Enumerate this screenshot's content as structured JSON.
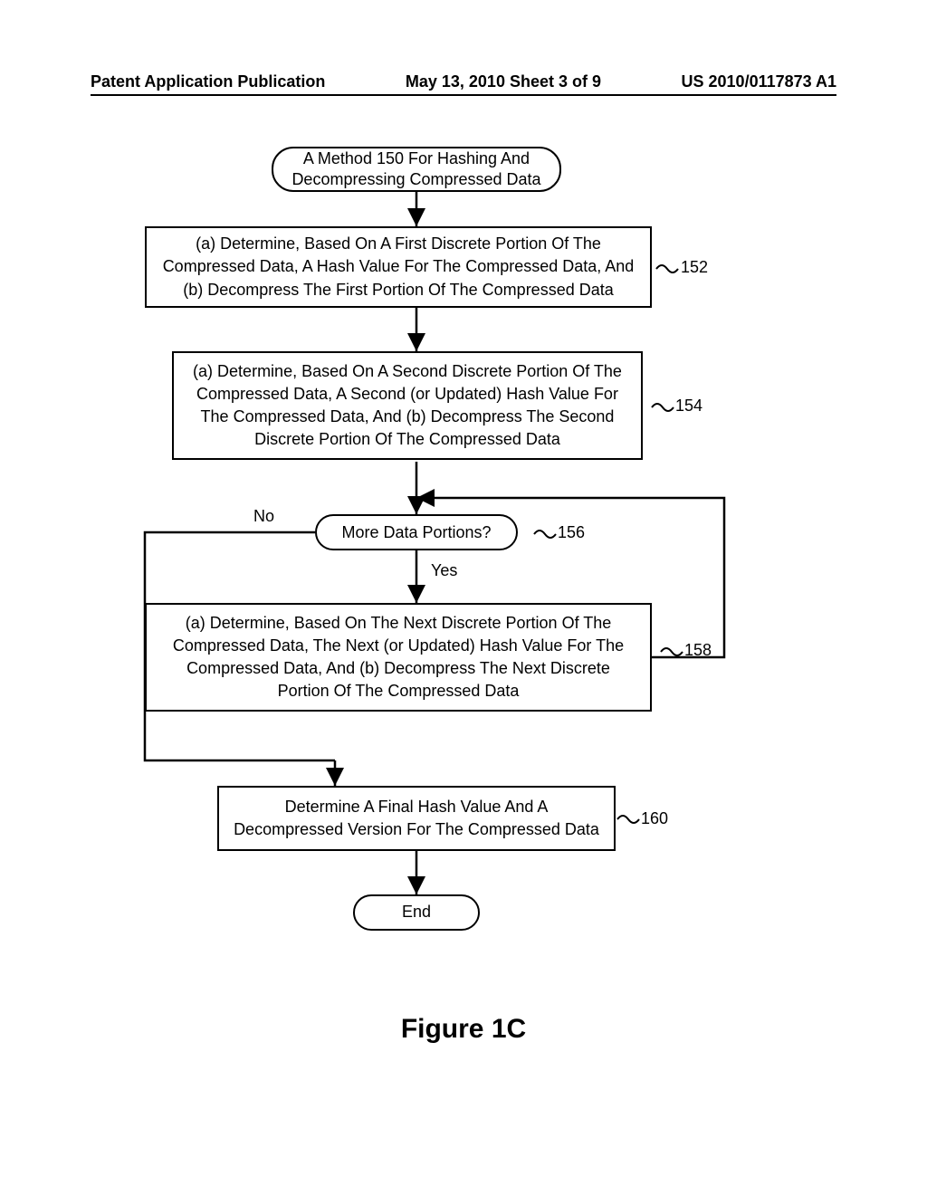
{
  "header": {
    "left": "Patent Application Publication",
    "center": "May 13, 2010  Sheet 3 of 9",
    "right": "US 2010/0117873 A1"
  },
  "flow": {
    "start": "A Method 150 For Hashing And Decompressing Compressed Data",
    "step152": "(a) Determine, Based On A First Discrete Portion Of The Compressed Data, A Hash Value For The Compressed Data, And (b) Decompress The First Portion Of The Compressed Data",
    "step154": "(a) Determine, Based On A Second Discrete Portion Of The Compressed Data, A Second (or Updated) Hash Value For The Compressed Data, And (b) Decompress The Second Discrete Portion Of The Compressed Data",
    "decision156": "More Data Portions?",
    "step158": "(a) Determine, Based On The Next Discrete Portion Of The Compressed Data, The Next (or Updated)  Hash Value For The Compressed Data, And (b) Decompress The Next Discrete Portion Of The Compressed Data",
    "step160": "Determine A Final Hash Value And A Decompressed Version For The Compressed Data",
    "end": "End"
  },
  "refs": {
    "r152": "152",
    "r154": "154",
    "r156": "156",
    "r158": "158",
    "r160": "160"
  },
  "labels": {
    "no": "No",
    "yes": "Yes"
  },
  "figure": "Figure 1C",
  "chart_data": {
    "type": "flowchart",
    "title": "A Method 150 For Hashing And Decompressing Compressed Data",
    "nodes": [
      {
        "id": "start",
        "shape": "terminator",
        "text": "A Method 150 For Hashing And Decompressing Compressed Data"
      },
      {
        "id": "152",
        "shape": "process",
        "text": "(a) Determine, Based On A First Discrete Portion Of The Compressed Data, A Hash Value For The Compressed Data, And (b) Decompress The First Portion Of The Compressed Data"
      },
      {
        "id": "154",
        "shape": "process",
        "text": "(a) Determine, Based On A Second Discrete Portion Of The Compressed Data, A Second (or Updated) Hash Value For The Compressed Data, And (b) Decompress The Second Discrete Portion Of The Compressed Data"
      },
      {
        "id": "156",
        "shape": "decision",
        "text": "More Data Portions?"
      },
      {
        "id": "158",
        "shape": "process",
        "text": "(a) Determine, Based On The Next Discrete Portion Of The Compressed Data, The Next (or Updated) Hash Value For The Compressed Data, And (b) Decompress The Next Discrete Portion Of The Compressed Data"
      },
      {
        "id": "160",
        "shape": "process",
        "text": "Determine A Final Hash Value And A Decompressed Version For The Compressed Data"
      },
      {
        "id": "end",
        "shape": "terminator",
        "text": "End"
      }
    ],
    "edges": [
      {
        "from": "start",
        "to": "152"
      },
      {
        "from": "152",
        "to": "154"
      },
      {
        "from": "154",
        "to": "156"
      },
      {
        "from": "156",
        "to": "158",
        "label": "Yes"
      },
      {
        "from": "156",
        "to": "160",
        "label": "No"
      },
      {
        "from": "158",
        "to": "156",
        "loop": true
      },
      {
        "from": "160",
        "to": "end"
      }
    ]
  }
}
